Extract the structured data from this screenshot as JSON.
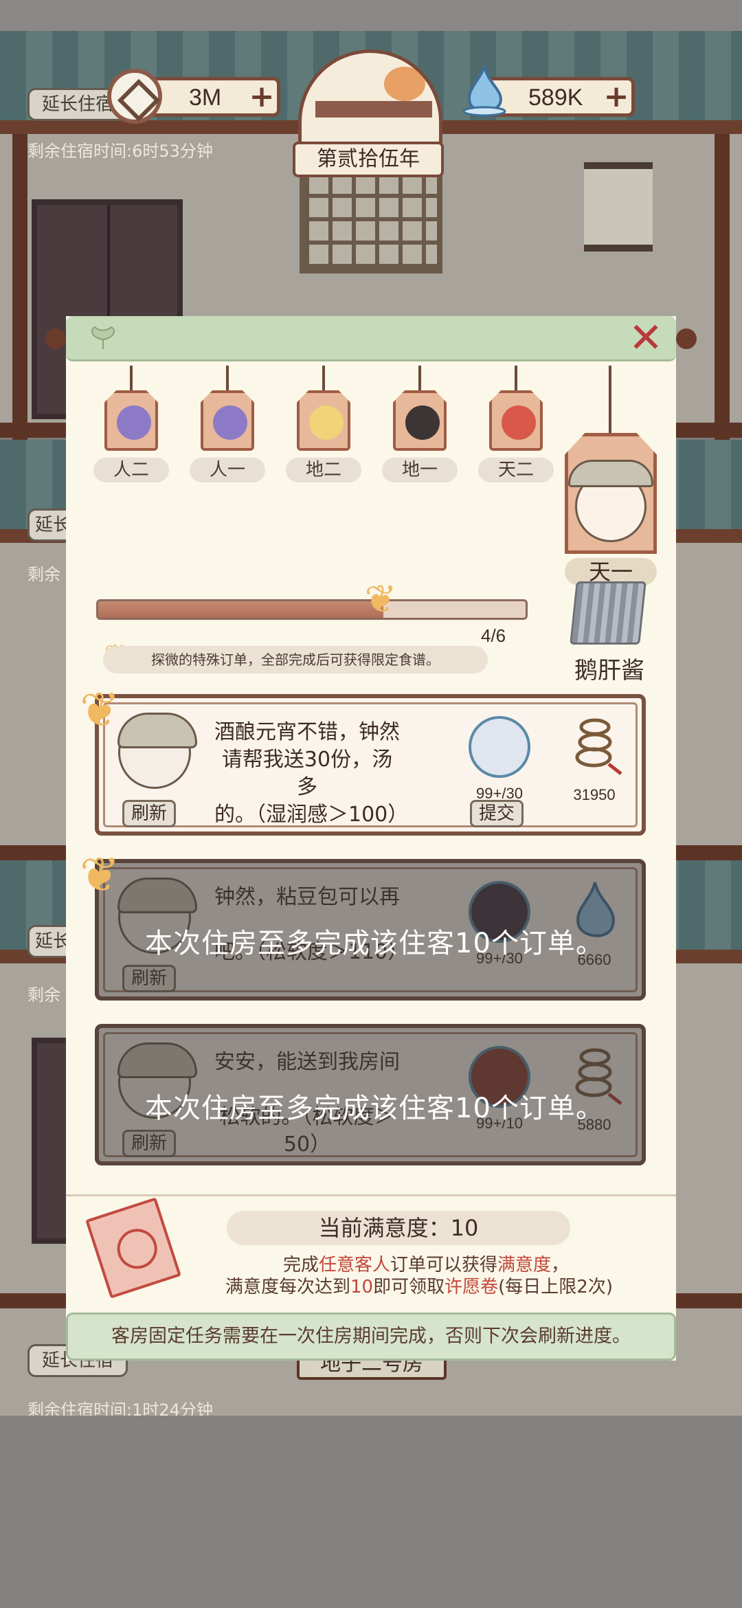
{
  "hud": {
    "coins": "3M",
    "jade": "589K",
    "year": "第贰拾伍年",
    "plus": "+"
  },
  "background": {
    "extend_label": "延长住宿",
    "extend_short": "延长",
    "extend_mid": "延",
    "remain_top": "剩余住宿时间:6时53分钟",
    "remain_bottom": "剩余住宿时间:1时24分钟",
    "remain_short": "剩余",
    "room_title_bottom": "地子二号房",
    "room_title_top": "房"
  },
  "modal": {
    "close_symbol": "✕",
    "guests": [
      {
        "label": "人二",
        "face": "purple-bun-icon",
        "color": "#8d7ac7"
      },
      {
        "label": "人一",
        "face": "purple-bun-icon",
        "color": "#8d7ac7"
      },
      {
        "label": "地二",
        "face": "blonde-character-icon",
        "color": "#f1d37a"
      },
      {
        "label": "地一",
        "face": "dark-hair-character-icon",
        "color": "#3d3436"
      },
      {
        "label": "天二",
        "face": "red-hair-character-icon",
        "color": "#d8584a"
      }
    ],
    "selected_guest": "天一",
    "progress": {
      "current": 4,
      "total": 6,
      "text": "4/6"
    },
    "hint": "探微的特殊订单，全部完成后可获得限定食谱。",
    "recipe_name": "鹅肝酱",
    "orders": [
      {
        "lines": [
          "酒酿元宵不错，钟然",
          "请帮我送30份，汤多",
          "的。（湿润感＞100）"
        ],
        "qty": "99+/30",
        "reward": "31950",
        "refresh": "刷新",
        "submit": "提交",
        "dish_color": "#dfe6ef",
        "reward_icon": "copper-coin-string-icon",
        "locked": false
      },
      {
        "lines": [
          "钟然，粘豆包可以再",
          "",
          "吧。（松软度＞110）"
        ],
        "qty": "99+/30",
        "reward": "6660",
        "refresh": "刷新",
        "dish_color": "#3d2f3a",
        "reward_icon": "jade-drop-icon",
        "locked": true,
        "notice": "本次住房至多完成该住客10个订单。"
      },
      {
        "lines": [
          "安安，能送到我房间",
          "",
          "松软的。（松软度＞",
          "50）"
        ],
        "qty": "99+/10",
        "reward": "5880",
        "refresh": "刷新",
        "dish_color": "#8a3a2a",
        "reward_icon": "copper-coin-string-icon",
        "locked": true,
        "notice": "本次住房至多完成该住客10个订单。"
      }
    ],
    "satisfaction": {
      "title": "当前满意度：10",
      "line1_a": "完成",
      "line1_hl1": "任意客人",
      "line1_b": "订单可以获得",
      "line1_hl2": "满意度",
      "line1_c": "，",
      "line2_a": "满意度每次达到",
      "line2_hl1": "10",
      "line2_b": "即可领取",
      "line2_hl2": "许愿卷",
      "line2_c": "(每日上限2次)"
    },
    "footer": "客房固定任务需要在一次住房期间完成，否则下次会刷新进度。"
  }
}
